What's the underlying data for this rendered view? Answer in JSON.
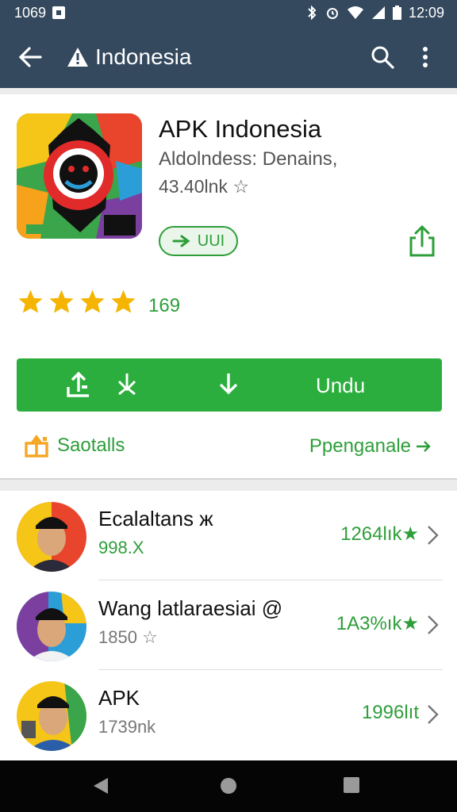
{
  "status_bar": {
    "left_text": "1069",
    "time": "12:09"
  },
  "app_bar": {
    "title": "Indonesia",
    "icons": [
      "back-arrow-icon",
      "warning-icon",
      "search-icon",
      "more-vert-icon"
    ]
  },
  "app": {
    "name": "APK Indonesia",
    "developer": "Aldolndess: Denains,",
    "size": "43.40lnk",
    "size_icon": "star-outline-icon",
    "badge_label": "UUI",
    "rating_count": "169",
    "rating_stars": 4,
    "install_label": "Undu",
    "details_label": "Saotalls",
    "more_label": "Ppenganale"
  },
  "list": [
    {
      "name": "Ecalaltans",
      "name_suffix": "ж",
      "subtitle": "998.Х",
      "subtitle_color": "green",
      "value": "1264lık"
    },
    {
      "name": "Wang latlaraesiai",
      "name_suffix": "@",
      "subtitle": "1850",
      "subtitle_color": "grey",
      "value": "1A3%ık"
    },
    {
      "name": "APK",
      "name_suffix": "",
      "subtitle": "1739nk",
      "subtitle_color": "grey",
      "value": "1996lıt"
    }
  ],
  "colors": {
    "app_bar": "#34495e",
    "accent_green": "#2bae3d",
    "star": "#f4b400"
  }
}
